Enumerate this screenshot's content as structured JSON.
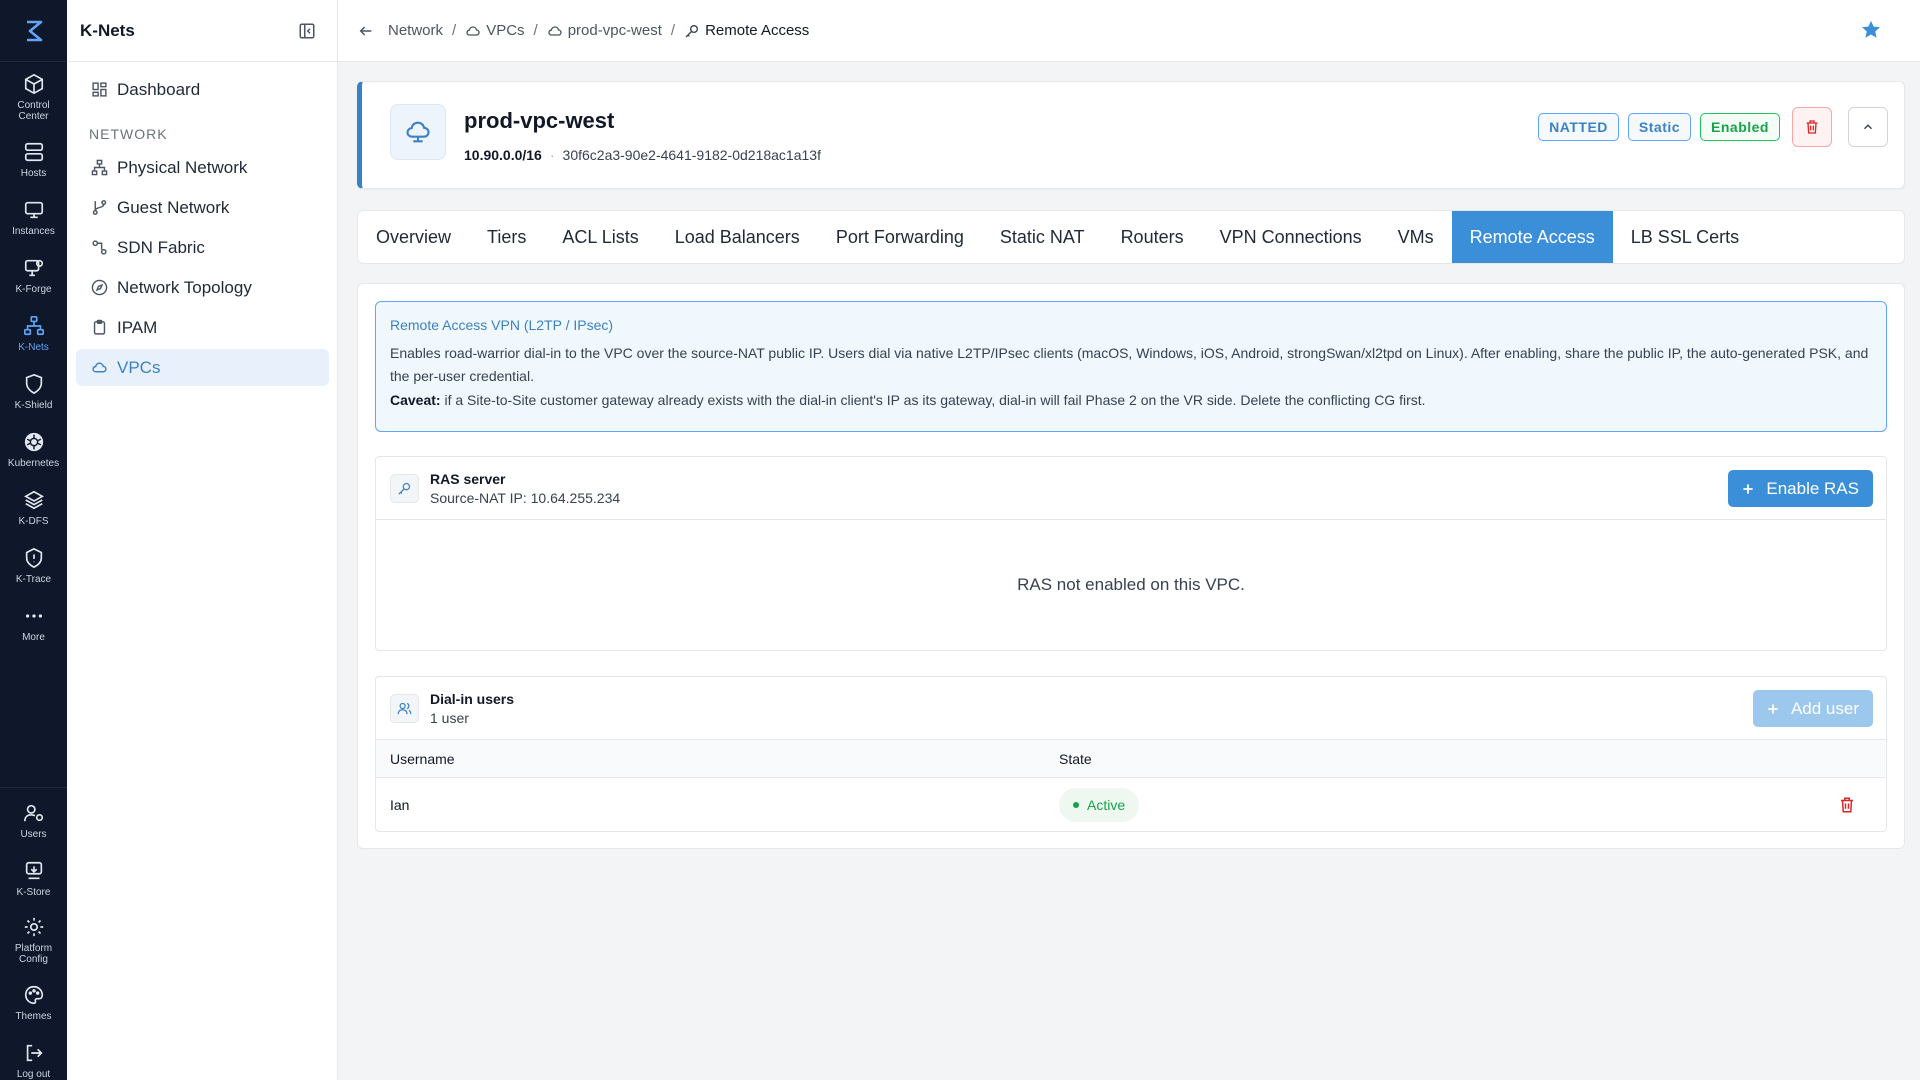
{
  "rail": {
    "items": [
      {
        "label": "Control\nCenter",
        "icon": "cube-icon"
      },
      {
        "label": "Hosts",
        "icon": "server-icon"
      },
      {
        "label": "Instances",
        "icon": "monitor-icon"
      },
      {
        "label": "K-Forge",
        "icon": "forge-icon"
      },
      {
        "label": "K-Nets",
        "icon": "network-icon"
      },
      {
        "label": "K-Shield",
        "icon": "shield-icon"
      },
      {
        "label": "Kubernetes",
        "icon": "kubernetes-icon"
      },
      {
        "label": "K-DFS",
        "icon": "layers-icon"
      },
      {
        "label": "K-Trace",
        "icon": "trace-icon"
      },
      {
        "label": "More",
        "icon": "more-icon"
      }
    ],
    "bottom": [
      {
        "label": "Users",
        "icon": "users-icon"
      },
      {
        "label": "K-Store",
        "icon": "store-icon"
      },
      {
        "label": "Platform\nConfig",
        "icon": "gear-icon"
      },
      {
        "label": "Themes",
        "icon": "palette-icon"
      },
      {
        "label": "Log out",
        "icon": "logout-icon"
      }
    ]
  },
  "sidebar": {
    "title": "K-Nets",
    "dashboard": "Dashboard",
    "section": "NETWORK",
    "items": [
      "Physical Network",
      "Guest Network",
      "SDN Fabric",
      "Network Topology",
      "IPAM",
      "VPCs"
    ]
  },
  "breadcrumb": {
    "items": [
      "Network",
      "VPCs",
      "prod-vpc-west",
      "Remote Access"
    ],
    "sep": "/"
  },
  "vpc": {
    "name": "prod-vpc-west",
    "cidr": "10.90.0.0/16",
    "dot": "·",
    "uuid": "30f6c2a3-90e2-4641-9182-0d218ac1a13f",
    "badges": [
      "NATTED",
      "Static",
      "Enabled"
    ]
  },
  "tabs": [
    "Overview",
    "Tiers",
    "ACL Lists",
    "Load Balancers",
    "Port Forwarding",
    "Static NAT",
    "Routers",
    "VPN Connections",
    "VMs",
    "Remote Access",
    "LB SSL Certs"
  ],
  "info": {
    "title": "Remote Access VPN (L2TP / IPsec)",
    "text": "Enables road-warrior dial-in to the VPC over the source-NAT public IP. Users dial via native L2TP/IPsec clients (macOS, Windows, iOS, Android, strongSwan/xl2tpd on Linux). After enabling, share the public IP, the auto-generated PSK, and the per-user credential.",
    "caveat_label": "Caveat:",
    "caveat_text": " if a Site-to-Site customer gateway already exists with the dial-in client's IP as its gateway, dial-in will fail Phase 2 on the VR side. Delete the conflicting CG first."
  },
  "ras": {
    "title": "RAS server",
    "subtitle": "Source-NAT IP: 10.64.255.234",
    "button": "Enable RAS",
    "empty": "RAS not enabled on this VPC."
  },
  "users": {
    "title": "Dial-in users",
    "subtitle": "1 user",
    "button": "Add user",
    "columns": [
      "Username",
      "State"
    ],
    "rows": [
      {
        "username": "Ian",
        "state": "Active"
      }
    ]
  },
  "colors": {
    "accent": "#3b8fd8",
    "rail_bg": "#0f172a",
    "success": "#16a34a",
    "danger": "#dc2626"
  }
}
